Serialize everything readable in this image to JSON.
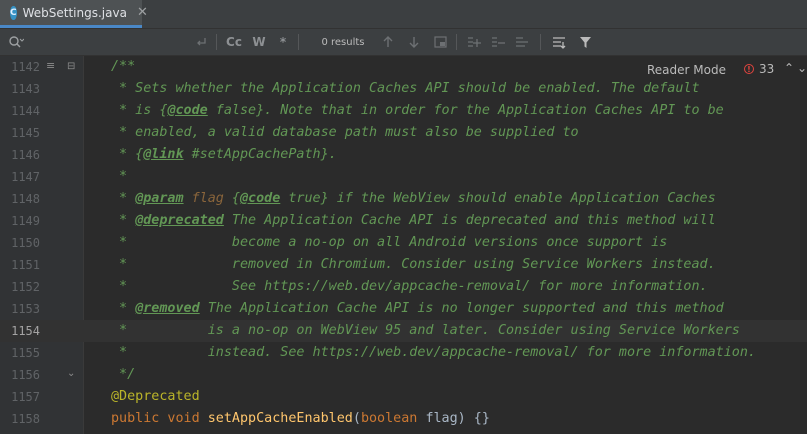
{
  "tab": {
    "file_icon": "C",
    "label": "WebSettings.java",
    "close": "✕"
  },
  "search": {
    "results": "0 results",
    "case_label": "Cc",
    "word_label": "W",
    "regex_label": "*"
  },
  "editor": {
    "reader_mode": "Reader Mode",
    "error_count": "33",
    "error_icon": "!",
    "nav_up": "⌃",
    "nav_down": "⌄",
    "lines": [
      {
        "num": "1142",
        "parts": [
          {
            "c": "cm",
            "t": "/**"
          }
        ]
      },
      {
        "num": "1143",
        "parts": [
          {
            "c": "cm",
            "t": " * Sets whether the Application Caches API should be enabled. The default"
          }
        ]
      },
      {
        "num": "1144",
        "parts": [
          {
            "c": "cm",
            "t": " * is {"
          },
          {
            "c": "tag",
            "t": "@code"
          },
          {
            "c": "cm",
            "t": " false}. Note that in order for the Application Caches API to be"
          }
        ]
      },
      {
        "num": "1145",
        "parts": [
          {
            "c": "cm",
            "t": " * enabled, a valid database path must also be supplied to"
          }
        ]
      },
      {
        "num": "1146",
        "parts": [
          {
            "c": "cm",
            "t": " * {"
          },
          {
            "c": "tag",
            "t": "@link"
          },
          {
            "c": "cm",
            "t": " #setAppCachePath}."
          }
        ]
      },
      {
        "num": "1147",
        "parts": [
          {
            "c": "cm",
            "t": " *"
          }
        ]
      },
      {
        "num": "1148",
        "parts": [
          {
            "c": "cm",
            "t": " * "
          },
          {
            "c": "tag",
            "t": "@param"
          },
          {
            "c": "cm",
            "t": " "
          },
          {
            "c": "pn",
            "t": "flag"
          },
          {
            "c": "cm",
            "t": " {"
          },
          {
            "c": "tag",
            "t": "@code"
          },
          {
            "c": "cm",
            "t": " true} if the WebView should enable Application Caches"
          }
        ]
      },
      {
        "num": "1149",
        "parts": [
          {
            "c": "cm",
            "t": " * "
          },
          {
            "c": "tag",
            "t": "@deprecated"
          },
          {
            "c": "cm",
            "t": " The Application Cache API is deprecated and this method will"
          }
        ]
      },
      {
        "num": "1150",
        "parts": [
          {
            "c": "cm",
            "t": " *             become a no-op on all Android versions once support is"
          }
        ]
      },
      {
        "num": "1151",
        "parts": [
          {
            "c": "cm",
            "t": " *             removed in Chromium. Consider using Service Workers instead."
          }
        ]
      },
      {
        "num": "1152",
        "parts": [
          {
            "c": "cm",
            "t": " *             See https://web.dev/appcache-removal/ for more information."
          }
        ]
      },
      {
        "num": "1153",
        "parts": [
          {
            "c": "cm",
            "t": " * "
          },
          {
            "c": "tag",
            "t": "@removed"
          },
          {
            "c": "cm",
            "t": " The Application Cache API is no longer supported and this method"
          }
        ]
      },
      {
        "num": "1154",
        "parts": [
          {
            "c": "cm",
            "t": " *          is a no-op on WebView 95 and later. Consider using Service Workers"
          }
        ]
      },
      {
        "num": "1155",
        "parts": [
          {
            "c": "cm",
            "t": " *          instead. See https://web.dev/appcache-removal/ for more information."
          }
        ]
      },
      {
        "num": "1156",
        "parts": [
          {
            "c": "cm",
            "t": " */"
          }
        ]
      },
      {
        "num": "1157",
        "parts": [
          {
            "c": "ann",
            "t": "@Deprecated"
          }
        ]
      },
      {
        "num": "1158",
        "parts": [
          {
            "c": "kw",
            "t": "public void "
          },
          {
            "c": "fn",
            "t": "setAppCacheEnabled"
          },
          {
            "c": "plain",
            "t": "("
          },
          {
            "c": "kw",
            "t": "boolean "
          },
          {
            "c": "plain",
            "t": "flag) {}"
          }
        ]
      }
    ],
    "current_line": "1154"
  },
  "colors": {
    "background": "#2b2b2b",
    "comment": "#629755",
    "keyword": "#cc7832",
    "function": "#ffc66d",
    "annotation": "#bbb529",
    "error": "#e0443e"
  }
}
